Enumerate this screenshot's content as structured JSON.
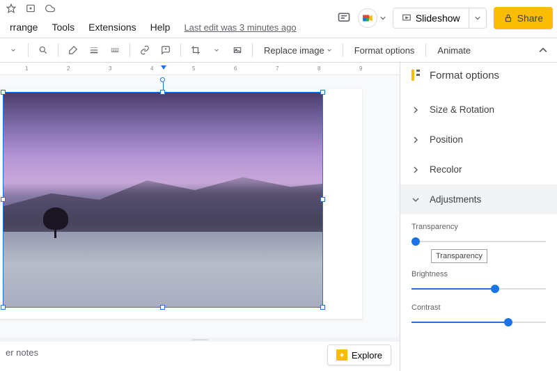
{
  "topIcons": [
    "star",
    "add-folder",
    "cloud"
  ],
  "menu": {
    "items": [
      "rrange",
      "Tools",
      "Extensions",
      "Help"
    ],
    "lastEdit": "Last edit was 3 minutes ago"
  },
  "header": {
    "slideshow": "Slideshow",
    "share": "Share"
  },
  "toolbar": {
    "replace": "Replace image",
    "formatOptions": "Format options",
    "animate": "Animate"
  },
  "ruler": {
    "marks": [
      1,
      2,
      3,
      4,
      5,
      6,
      7,
      8,
      9
    ]
  },
  "notes": {
    "placeholder": "er notes"
  },
  "explore": {
    "label": "Explore"
  },
  "panel": {
    "title": "Format options",
    "sections": [
      {
        "label": "Size & Rotation",
        "expanded": false
      },
      {
        "label": "Position",
        "expanded": false
      },
      {
        "label": "Recolor",
        "expanded": false
      },
      {
        "label": "Adjustments",
        "expanded": true
      }
    ],
    "adjustments": {
      "transparency": {
        "label": "Transparency",
        "value": 3,
        "tooltip": "Transparency"
      },
      "brightness": {
        "label": "Brightness",
        "value": 62
      },
      "contrast": {
        "label": "Contrast",
        "value": 72
      }
    }
  }
}
